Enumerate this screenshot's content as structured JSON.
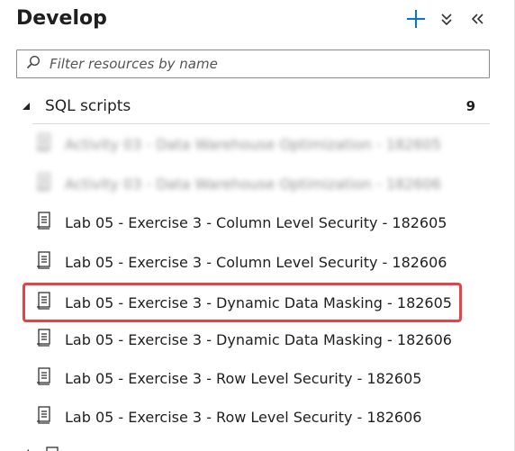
{
  "header": {
    "title": "Develop"
  },
  "toolbar": {
    "add_icon": "plus-icon",
    "expand_icon": "expand-all-icon",
    "collapse_icon": "collapse-panel-icon",
    "accent_color": "#0078d4"
  },
  "filter": {
    "placeholder": "Filter resources by name",
    "value": ""
  },
  "section": {
    "label": "SQL scripts",
    "count": "9",
    "state": "expanded"
  },
  "items": [
    {
      "label": "Activity 03 - Data Warehouse Optimization - 182605",
      "blurred": true
    },
    {
      "label": "Activity 03 - Data Warehouse Optimization - 182606",
      "blurred": true
    },
    {
      "label": "Lab 05 - Exercise 3 - Column Level Security - 182605",
      "blurred": false
    },
    {
      "label": "Lab 05 - Exercise 3 - Column Level Security - 182606",
      "blurred": false
    },
    {
      "label": "Lab 05 - Exercise 3 - Dynamic Data Masking - 182605",
      "blurred": false,
      "highlighted": true
    },
    {
      "label": "Lab 05 - Exercise 3 - Dynamic Data Masking - 182606",
      "blurred": false
    },
    {
      "label": "Lab 05 - Exercise 3 - Row Level Security - 182605",
      "blurred": false
    },
    {
      "label": "Lab 05 - Exercise 3 - Row Level Security - 182606",
      "blurred": false
    }
  ],
  "highlight_color": "#e0454a"
}
